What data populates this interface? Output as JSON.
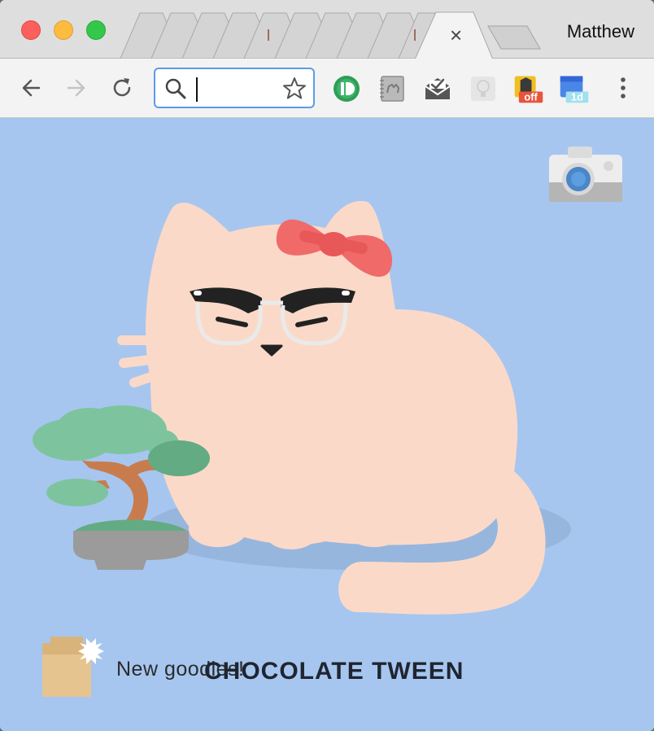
{
  "browser": {
    "profile_name": "Matthew",
    "active_tab_close": "×",
    "omnibox": {
      "value": "",
      "placeholder": ""
    },
    "extensions": [
      {
        "name": "pushbullet-icon",
        "color": "#2e9e57",
        "badge": ""
      },
      {
        "name": "notebook-camel-icon",
        "color": "#9a9a9a",
        "badge": ""
      },
      {
        "name": "mail-check-icon",
        "color": "#555555",
        "badge": ""
      },
      {
        "name": "lightbulb-icon",
        "color": "#c9c9c9",
        "badge": ""
      },
      {
        "name": "shopping-tag-icon",
        "color": "#f0c020",
        "badge": "off"
      },
      {
        "name": "calendar-icon",
        "color": "#4a86e8",
        "badge": "1d"
      }
    ]
  },
  "page": {
    "background_color": "#a6c6ef",
    "footer": {
      "new_goodies": "New goodies!",
      "cat_name": "CHOCOLATE TWEEN"
    }
  }
}
